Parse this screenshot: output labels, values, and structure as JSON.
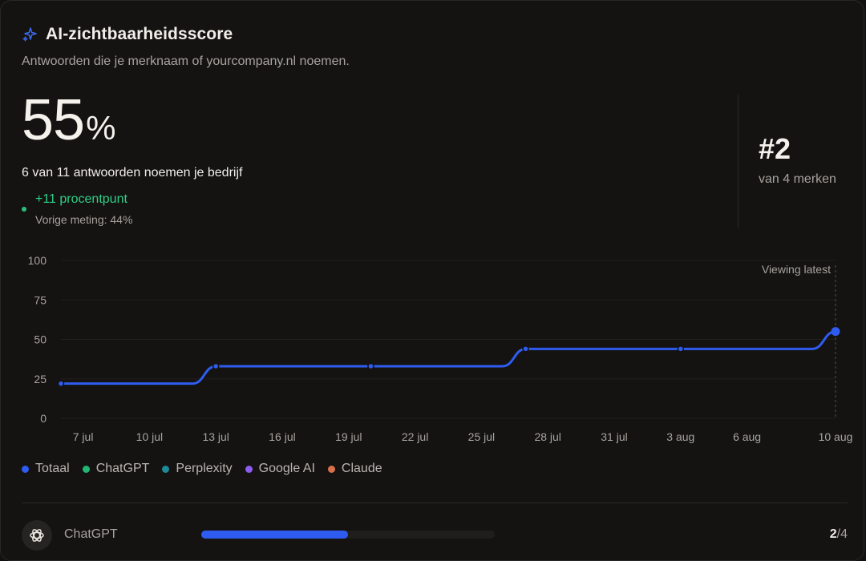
{
  "header": {
    "title": "AI-zichtbaarheidsscore",
    "subtitle": "Antwoorden die je merknaam of yourcompany.nl noemen."
  },
  "score": {
    "value": "55",
    "unit": "%",
    "count_text": "6 van 11 antwoorden noemen je bedrijf",
    "delta_text": "+11 procentpunt",
    "previous_text": "Vorige meting: 44%"
  },
  "rank": {
    "value": "#2",
    "subtitle": "van 4 merken"
  },
  "chart_data": {
    "type": "line",
    "annotation": "Viewing latest",
    "ylim": [
      0,
      100
    ],
    "yticks": [
      0,
      25,
      50,
      75,
      100
    ],
    "xticks": [
      "7 jul",
      "10 jul",
      "13 jul",
      "16 jul",
      "19 jul",
      "22 jul",
      "25 jul",
      "28 jul",
      "31 jul",
      "3 aug",
      "6 aug",
      "10 aug"
    ],
    "grid": true,
    "series": [
      {
        "name": "Totaal",
        "color": "#2f5cf0",
        "points": [
          {
            "x": "6 jul",
            "y": 22
          },
          {
            "x": "13 jul",
            "y": 33
          },
          {
            "x": "20 jul",
            "y": 33
          },
          {
            "x": "27 jul",
            "y": 44
          },
          {
            "x": "3 aug",
            "y": 44
          },
          {
            "x": "10 aug",
            "y": 55
          }
        ]
      }
    ]
  },
  "legend": [
    {
      "label": "Totaal",
      "color": "#2f5cf0"
    },
    {
      "label": "ChatGPT",
      "color": "#22b773"
    },
    {
      "label": "Perplexity",
      "color": "#1f8a96"
    },
    {
      "label": "Google AI",
      "color": "#8f5cf0"
    },
    {
      "label": "Claude",
      "color": "#d9704a"
    }
  ],
  "engines": [
    {
      "name": "ChatGPT",
      "icon": "openai-icon",
      "mentioned": "2",
      "total": "/4",
      "fraction": 0.5
    }
  ]
}
